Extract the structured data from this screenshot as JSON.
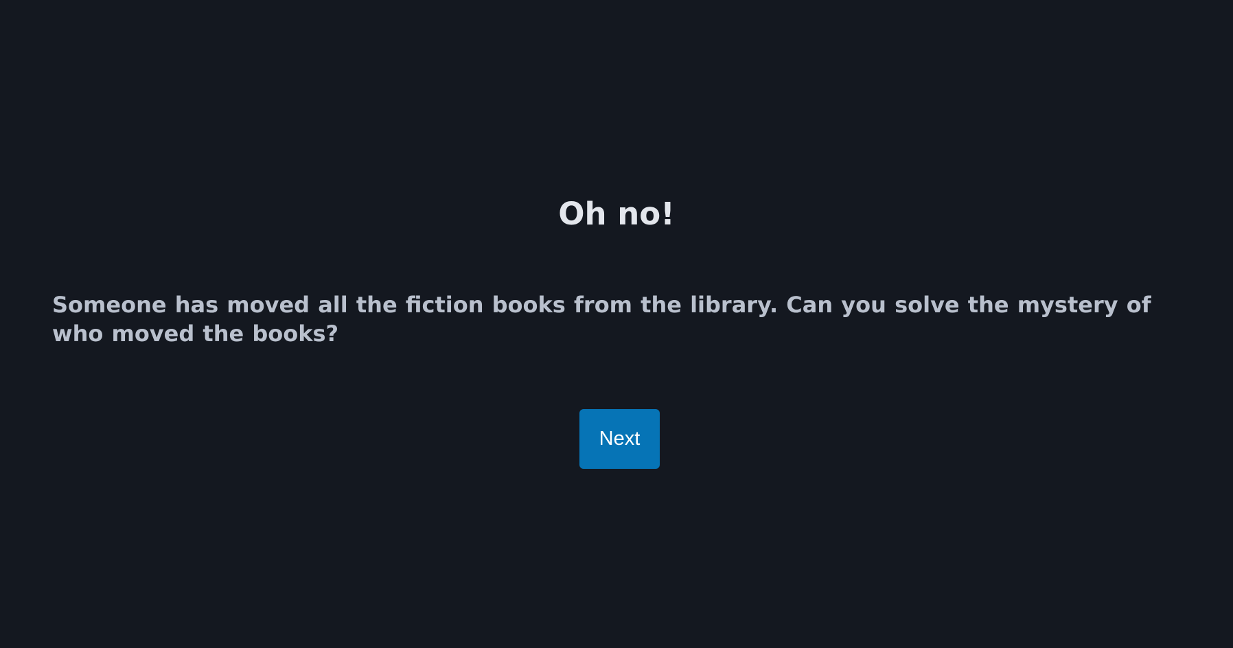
{
  "intro": {
    "title": "Oh no!",
    "story": "Someone has moved all the fiction books from the library. Can you solve the mystery of who moved the books?",
    "next_label": "Next"
  },
  "colors": {
    "background": "#141820",
    "title_text": "#e3e6ec",
    "story_text": "#b9c0cd",
    "button_bg": "#0674b6",
    "button_text": "#ffffff"
  }
}
